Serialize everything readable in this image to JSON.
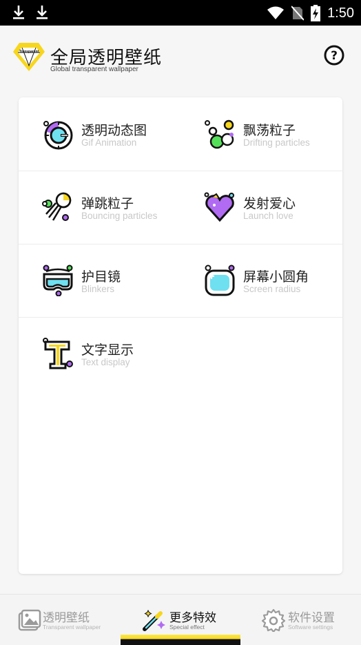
{
  "status_bar": {
    "time": "1:50"
  },
  "header": {
    "logo_text": "Transparent",
    "title": "全局透明壁纸",
    "subtitle": "Global transparent wallpaper"
  },
  "features": [
    {
      "zh": "透明动态图",
      "en": "Gif Animation",
      "icon": "gif-animation-icon"
    },
    {
      "zh": "飘荡粒子",
      "en": "Drifting particles",
      "icon": "drifting-particles-icon"
    },
    {
      "zh": "弹跳粒子",
      "en": "Bouncing particles",
      "icon": "bouncing-particles-icon"
    },
    {
      "zh": "发射爱心",
      "en": "Launch love",
      "icon": "launch-love-icon"
    },
    {
      "zh": "护目镜",
      "en": "Blinkers",
      "icon": "goggles-icon"
    },
    {
      "zh": "屏幕小圆角",
      "en": "Screen radius",
      "icon": "screen-radius-icon"
    },
    {
      "zh": "文字显示",
      "en": "Text display",
      "icon": "text-display-icon"
    }
  ],
  "bottom_nav": [
    {
      "zh": "透明壁纸",
      "en": "Transparent wallpaper",
      "icon": "wallpaper-icon",
      "active": false
    },
    {
      "zh": "更多特效",
      "en": "Special effect",
      "icon": "magic-wand-icon",
      "active": true
    },
    {
      "zh": "软件设置",
      "en": "Software settings",
      "icon": "gear-icon",
      "active": false
    }
  ],
  "colors": {
    "accent_yellow": "#f7d61e",
    "accent_purple": "#b06bf2",
    "accent_cyan": "#6fe0f0",
    "accent_green": "#55e05a"
  }
}
